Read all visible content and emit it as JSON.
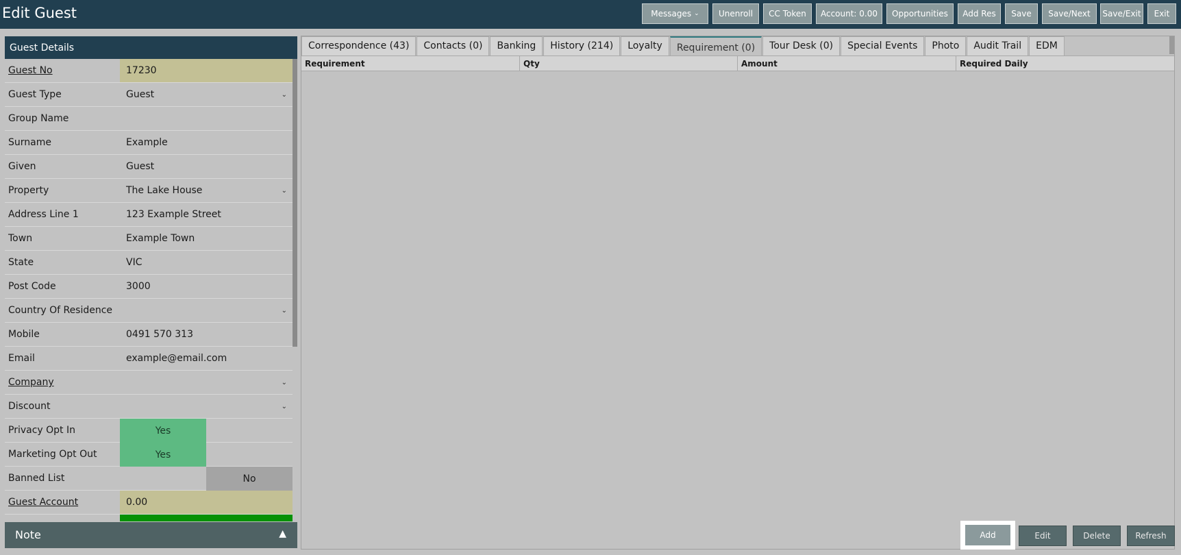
{
  "app": {
    "title": "Edit Guest"
  },
  "toolbar": {
    "messages": "Messages",
    "unenroll": "Unenroll",
    "cc_token": "CC Token",
    "account": "Account: 0.00",
    "opportunities": "Opportunities",
    "add_res": "Add Res",
    "save": "Save",
    "save_next": "Save/Next",
    "save_exit": "Save/Exit",
    "exit": "Exit"
  },
  "guest_details": {
    "header": "Guest Details",
    "fields": [
      {
        "label": "Guest No",
        "value": "17230"
      },
      {
        "label": "Guest Type",
        "value": "Guest"
      },
      {
        "label": "Group Name",
        "value": ""
      },
      {
        "label": "Surname",
        "value": "Example"
      },
      {
        "label": "Given",
        "value": "Guest"
      },
      {
        "label": "Property",
        "value": "The Lake House"
      },
      {
        "label": "Address Line 1",
        "value": "123 Example Street"
      },
      {
        "label": "Town",
        "value": "Example Town"
      },
      {
        "label": "State",
        "value": "VIC"
      },
      {
        "label": "Post Code",
        "value": "3000"
      },
      {
        "label": "Country Of Residence",
        "value": ""
      },
      {
        "label": "Mobile",
        "value": "0491 570 313"
      },
      {
        "label": "Email",
        "value": "example@email.com"
      },
      {
        "label": "Company",
        "value": ""
      },
      {
        "label": "Discount",
        "value": ""
      },
      {
        "label": "Privacy Opt In",
        "value": "Yes"
      },
      {
        "label": "Marketing Opt Out",
        "value": "Yes"
      },
      {
        "label": "Banned List",
        "value": "No"
      },
      {
        "label": "Guest Account",
        "value": "0.00"
      }
    ]
  },
  "note": {
    "label": "Note"
  },
  "tabs": [
    "Correspondence (43)",
    "Contacts (0)",
    "Banking",
    "History (214)",
    "Loyalty",
    "Requirement (0)",
    "Tour Desk (0)",
    "Special Events",
    "Photo",
    "Audit Trail",
    "EDM"
  ],
  "grid": {
    "columns": [
      "Requirement",
      "Qty",
      "Amount",
      "Required Daily"
    ]
  },
  "actions": {
    "add": "Add",
    "edit": "Edit",
    "delete": "Delete",
    "refresh": "Refresh"
  },
  "colors": {
    "topbar": "#213f50",
    "highlight_field": "#c3c095",
    "toggle_yes": "#5dba82",
    "toggle_no": "#a4a4a4",
    "action_button": "#566a6c"
  }
}
